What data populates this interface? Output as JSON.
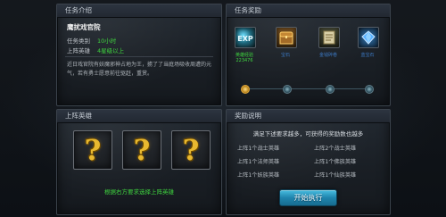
{
  "intro": {
    "title": "任务介绍",
    "task_name": "鹰扰戏官院",
    "level_label": "任务类别",
    "level_value": "10小时",
    "req_label": "上阵英雄",
    "req_value": "4星级以上",
    "description": "近日戏官院有妖魔邪神占地为王，掳了了当庭场吸收周遭的元气，若有勇士愿意前往驱赶，重赏。"
  },
  "reward": {
    "title": "任务奖励",
    "items": [
      {
        "label": "英雄经验\n223476",
        "icon": "exp-book-icon",
        "color": "#1f5566"
      },
      {
        "label": "宝石",
        "icon": "treasure-chest-icon",
        "color": "#5b3b16"
      },
      {
        "label": "金钱碎卷",
        "icon": "scroll-icon",
        "color": "#3c3f2a"
      },
      {
        "label": "蓝宝石",
        "icon": "blue-gem-icon",
        "color": "#173a5a"
      }
    ]
  },
  "heroes": {
    "title": "上阵英雄",
    "hint": "根据右方要求选择上阵英雄",
    "slots": [
      "?",
      "?",
      "?"
    ]
  },
  "rules": {
    "title": "奖励说明",
    "headline": "满足下述要求越多，可获得的奖励数也越多",
    "left": [
      "上阵1个战士英雄",
      "上阵1个法师英雄",
      "上阵1个妖族英雄"
    ],
    "right": [
      "上阵2个战士英雄",
      "上阵1个佛族英雄",
      "上阵1个仙族英雄"
    ],
    "button": "开始执行"
  }
}
